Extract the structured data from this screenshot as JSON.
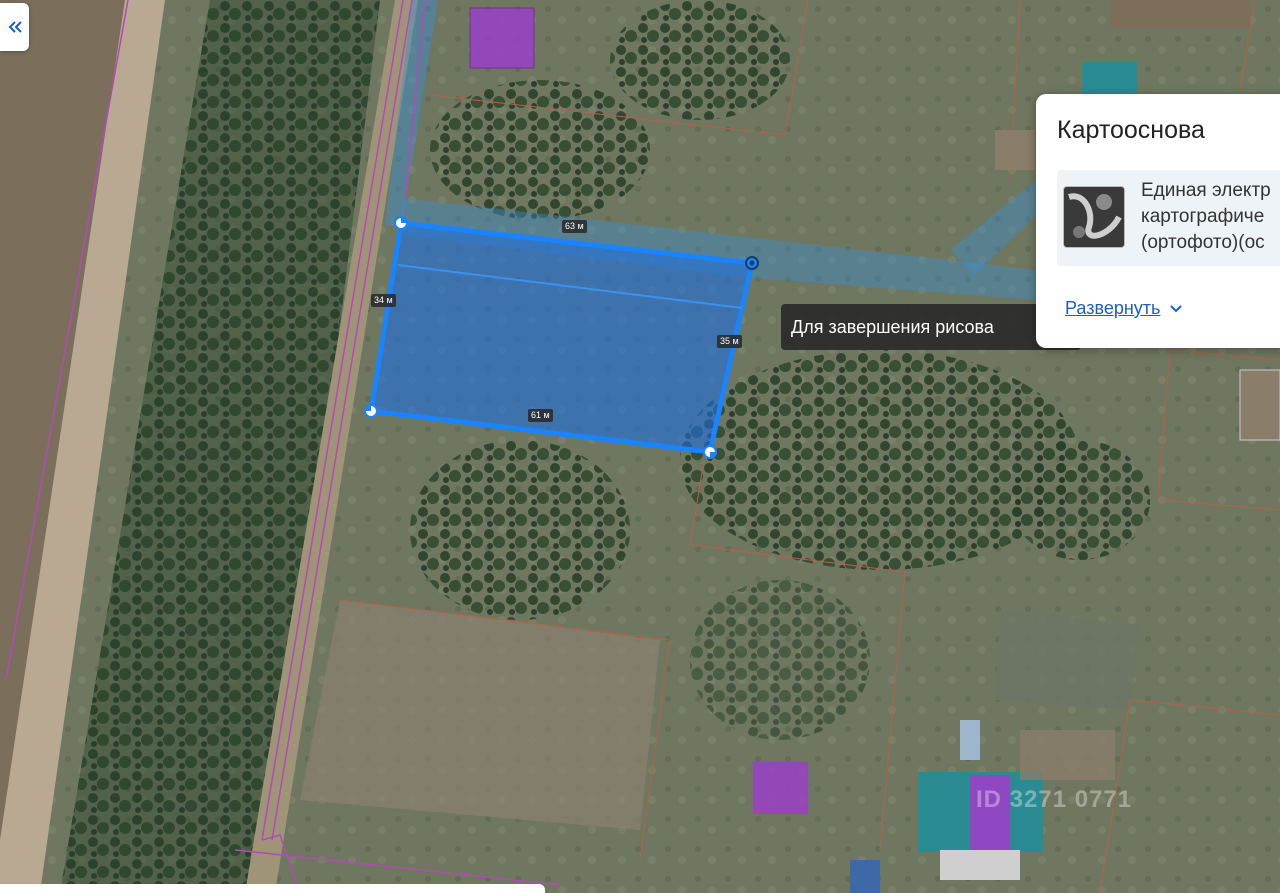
{
  "map": {
    "measurements": {
      "top": "63 м",
      "left": "34 м",
      "right": "35 м",
      "bottom": "61 м"
    },
    "tooltip": "Для завершения рисова",
    "watermark": "ID 3271 0771",
    "colors": {
      "polygon_fill": "#1e6fe0",
      "polygon_stroke": "#1a84ff",
      "parcel_border_purple": "#b24bb5",
      "parcel_border_orange": "#b4614c",
      "highlight_band": "#3a8fd6",
      "building_purple": "#9b3fc8"
    }
  },
  "controls": {
    "collapse_icon": "double-chevron-left-icon"
  },
  "layer_panel": {
    "title": "Картооснова",
    "layer_name": "Единая электр\nкартографиче\n(ортофото)(ос",
    "expand_label": "Развернуть",
    "expand_icon": "chevron-down-icon"
  }
}
